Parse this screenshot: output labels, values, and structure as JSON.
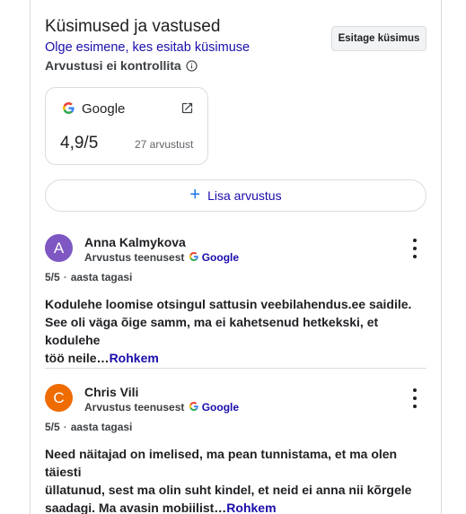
{
  "qa": {
    "title": "Küsimused ja vastused",
    "first_link": "Olge esimene, kes esitab küsimuse",
    "ask_button": "Esitage küsimus"
  },
  "reviews_note": "Arvustusi ei kontrollita",
  "source_card": {
    "source": "Google",
    "score": "4,9/5",
    "count": "27 arvustust"
  },
  "add_review": "Lisa arvustus",
  "reviews": [
    {
      "initial": "A",
      "avatar_color": "#7e57c2",
      "name": "Anna Kalmykova",
      "subtitle": "Arvustus teenusest",
      "platform": "Google",
      "rating": "5/5",
      "time": "aasta tagasi",
      "text_lines": [
        "Kodulehe loomise otsingul sattusin veebilahendus.ee saidile.",
        "See oli väga õige samm, ma ei kahetsenud hetkekski, et kodulehe",
        "töö neile…"
      ],
      "more": "Rohkem"
    },
    {
      "initial": "C",
      "avatar_color": "#ef6c00",
      "name": "Chris Vili",
      "subtitle": "Arvustus teenusest",
      "platform": "Google",
      "rating": "5/5",
      "time": "aasta tagasi",
      "text_lines": [
        "Need näitajad on imelised, ma pean tunnistama, et ma olen täiesti",
        "üllatunud, sest ma olin suht kindel, et neid ei anna nii kõrgele",
        "saadagi. Ma avasin mobiilist…"
      ],
      "more": "Rohkem"
    }
  ],
  "colors": {
    "link": "#1a0dab",
    "accent_blue": "#1a73e8",
    "border": "#dadce0"
  },
  "icons": [
    "info-icon",
    "google-g-icon",
    "external-link-icon",
    "plus-icon",
    "more-vert-icon"
  ]
}
